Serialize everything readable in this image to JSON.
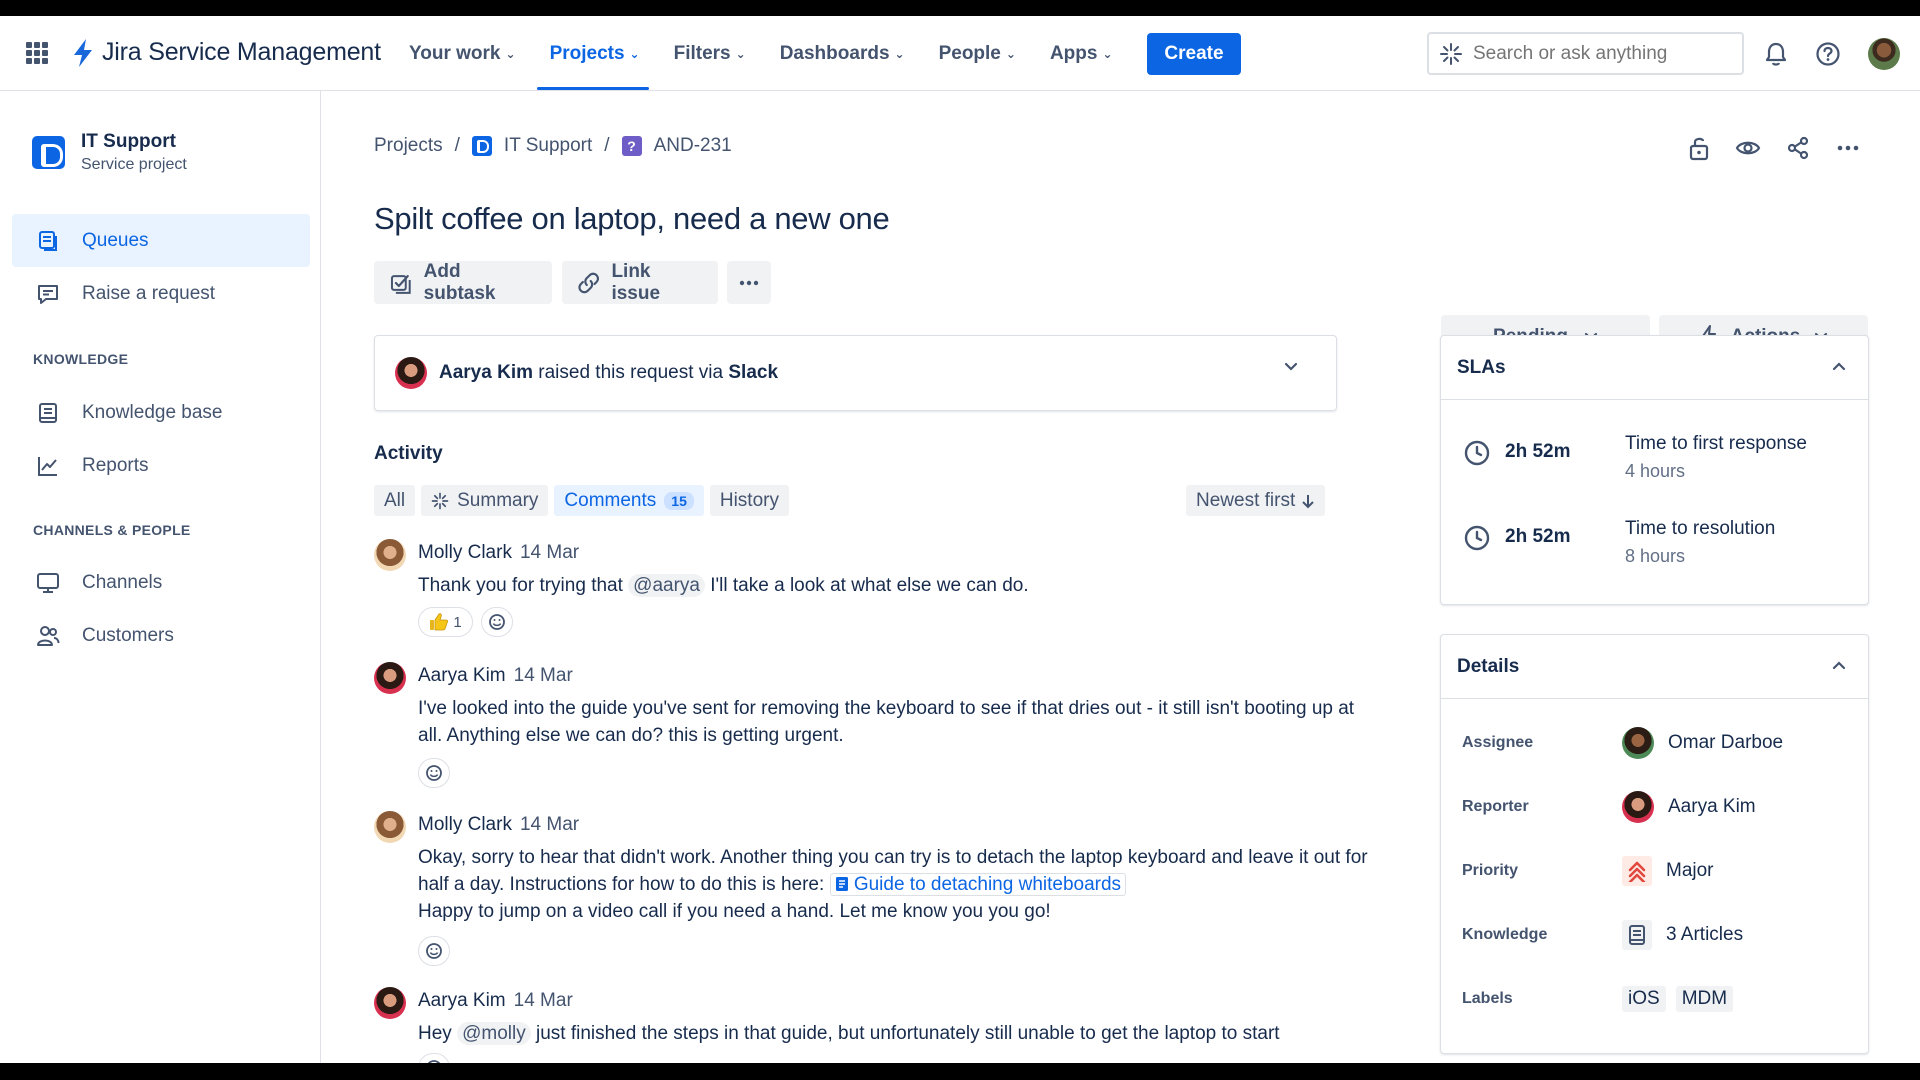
{
  "app": {
    "name": "Jira Service Management",
    "nav": [
      {
        "label": "Your work"
      },
      {
        "label": "Projects"
      },
      {
        "label": "Filters"
      },
      {
        "label": "Dashboards"
      },
      {
        "label": "People"
      },
      {
        "label": "Apps"
      }
    ],
    "create_label": "Create",
    "search_placeholder": "Search or ask anything"
  },
  "sidebar": {
    "project_name": "IT Support",
    "project_type": "Service project",
    "items_top": [
      {
        "label": "Queues"
      },
      {
        "label": "Raise a request"
      }
    ],
    "knowledge_heading": "KNOWLEDGE",
    "knowledge_items": [
      {
        "label": "Knowledge base"
      },
      {
        "label": "Reports"
      }
    ],
    "channels_heading": "CHANNELS & PEOPLE",
    "channels_items": [
      {
        "label": "Channels"
      },
      {
        "label": "Customers"
      }
    ]
  },
  "breadcrumb": {
    "projects": "Projects",
    "sep": "/",
    "project": "IT Support",
    "issue_key": "AND-231",
    "issue_glyph": "?"
  },
  "issue": {
    "title": "Spilt coffee on laptop, need a new one",
    "add_subtask": "Add subtask",
    "link_issue": "Link issue",
    "status": "Pending",
    "actions": "Actions",
    "raised": {
      "name": "Aarya Kim",
      "middle": " raised this request via ",
      "channel": "Slack"
    }
  },
  "activity": {
    "title": "Activity",
    "tabs": {
      "all": "All",
      "summary": "Summary",
      "comments": "Comments",
      "comments_count": "15",
      "history": "History"
    },
    "sort": "Newest first",
    "comments": [
      {
        "author": "Molly Clark",
        "date": "14 Mar",
        "pre": "Thank you for trying that ",
        "mention": "@aarya",
        "post": " I'll take a look at what else we can do.",
        "reaction_count": "1"
      },
      {
        "author": "Aarya Kim",
        "date": "14 Mar",
        "text": "I've looked into the guide you've sent for removing the keyboard to see if that dries out - it still isn't booting up at all. Anything else we can do? this is getting urgent."
      },
      {
        "author": "Molly Clark",
        "date": "14 Mar",
        "pre": "Okay, sorry to hear that didn't work. Another thing you can try is to detach the laptop keyboard and leave it out for half a day. Instructions for how to do this is here: ",
        "link": "Guide to detaching whiteboards",
        "post": "Happy to jump on a video call if you need a hand. Let me know you you go!"
      },
      {
        "author": "Aarya Kim",
        "date": "14 Mar",
        "pre": "Hey ",
        "mention": "@molly",
        "post": " just finished the steps in that guide, but unfortunately still unable to get the laptop to start"
      }
    ]
  },
  "slas": {
    "title": "SLAs",
    "items": [
      {
        "time": "2h 52m",
        "name": "Time to first response",
        "goal": "4 hours"
      },
      {
        "time": "2h 52m",
        "name": "Time to resolution",
        "goal": "8 hours"
      }
    ]
  },
  "details": {
    "title": "Details",
    "assignee_label": "Assignee",
    "assignee": "Omar Darboe",
    "reporter_label": "Reporter",
    "reporter": "Aarya Kim",
    "priority_label": "Priority",
    "priority": "Major",
    "knowledge_label": "Knowledge",
    "knowledge": "3 Articles",
    "labels_label": "Labels",
    "labels": [
      "iOS",
      "MDM"
    ]
  },
  "colors": {
    "brand_blue": "#0c66e4",
    "selected_bg": "#e9f2ff",
    "neutral_bg": "#f1f2f4",
    "priority_red": "#e2483d"
  }
}
